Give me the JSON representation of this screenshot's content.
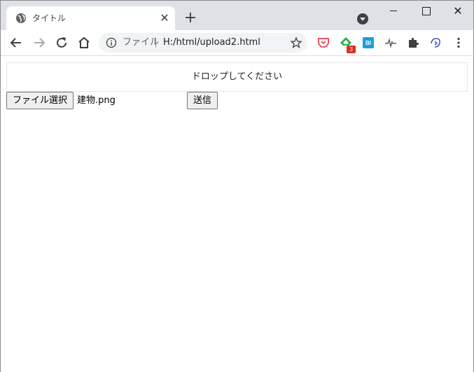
{
  "browser": {
    "tab": {
      "title": "タイトル"
    },
    "address": {
      "scheme_label": "ファイル",
      "url": "H:/html/upload2.html"
    },
    "extensions": {
      "feedly_badge": "3",
      "bi_label": "BI"
    },
    "colors": {
      "tabstrip": "#dee1e6",
      "omnibox": "#f1f3f4",
      "pocket": "#ef4056",
      "feedly": "#2bb24c",
      "bi": "#1a9fd9",
      "badge": "#d93025"
    }
  },
  "page": {
    "dropzone_text": "ドロップしてください",
    "file_button_label": "ファイル選択",
    "file_name": "建物.png",
    "submit_button_label": "送信"
  }
}
